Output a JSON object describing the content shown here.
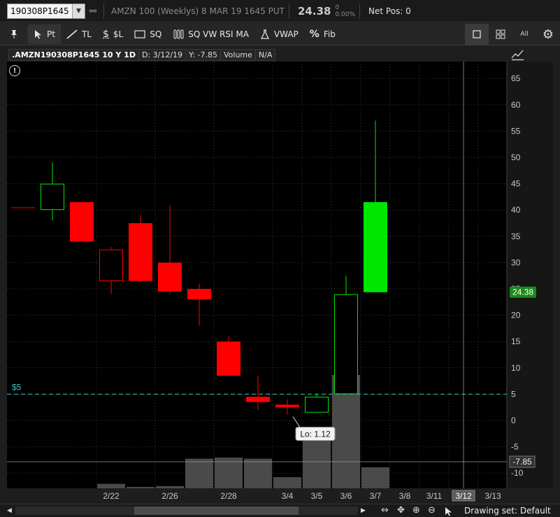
{
  "quote": {
    "symbol": "190308P1645",
    "description": "AMZN 100 (Weeklys) 8 MAR 19 1645 PUT",
    "last": "24.38",
    "change": "0",
    "change_pct": "0.00%",
    "net_pos": "Net Pos: 0"
  },
  "toolbar": {
    "pt": "Pt",
    "tl": "TL",
    "sl": "$L",
    "sq": "SQ",
    "study": "SQ VW RSI MA",
    "vwap": "VWAP",
    "fib": "Fib",
    "all": "All"
  },
  "header": {
    "symbol": ".AMZN190308P1645 10 Y 1D",
    "date": "D: 3/12/19",
    "y": "Y: -7.85",
    "volume": "Volume",
    "na": "N/A"
  },
  "bottom": {
    "drawing_set": "Drawing set: Default"
  },
  "colors": {
    "up": "#00e600",
    "down": "#ff0000",
    "volume": "#4a4a4a",
    "level": "#40c0c0",
    "last_badge": "#1a8a1a",
    "y_badge": "#333333"
  },
  "chart_data": {
    "type": "candlestick",
    "y_ticks": [
      65,
      60,
      55,
      50,
      45,
      40,
      35,
      30,
      25,
      20,
      15,
      10,
      5,
      0,
      -5,
      -10
    ],
    "ylim": [
      -13,
      67
    ],
    "x_labels": [
      {
        "label": "2/22",
        "index": 2
      },
      {
        "label": "2/26",
        "index": 4
      },
      {
        "label": "2/28",
        "index": 6
      },
      {
        "label": "3/4",
        "index": 8
      },
      {
        "label": "3/5",
        "index": 9
      },
      {
        "label": "3/6",
        "index": 10
      },
      {
        "label": "3/7",
        "index": 11
      },
      {
        "label": "3/8",
        "index": 12
      },
      {
        "label": "3/11",
        "index": 13
      },
      {
        "label": "3/12",
        "index": 14
      },
      {
        "label": "3/13",
        "index": 15
      }
    ],
    "candles": [
      {
        "index": 0,
        "open": 40.5,
        "high": 40.5,
        "low": 40.5,
        "close": 40.5,
        "color": "down",
        "filled": true
      },
      {
        "index": 1,
        "open": 40,
        "high": 49,
        "low": 38,
        "close": 45,
        "color": "up",
        "filled": false
      },
      {
        "index": 2,
        "open": 41.5,
        "high": 41.5,
        "low": 34,
        "close": 34,
        "color": "down",
        "filled": true
      },
      {
        "index": 3,
        "open": 26.5,
        "high": 33,
        "low": 24,
        "close": 32.5,
        "color": "down",
        "filled": false
      },
      {
        "index": 4,
        "open": 37.5,
        "high": 39,
        "low": 26.5,
        "close": 26.5,
        "color": "down",
        "filled": true
      },
      {
        "index": 5,
        "open": 30,
        "high": 41,
        "low": 24,
        "close": 24.5,
        "color": "down",
        "filled": true
      },
      {
        "index": 6,
        "open": 25,
        "high": 26,
        "low": 18,
        "close": 23,
        "color": "down",
        "filled": true
      },
      {
        "index": 7,
        "open": 15,
        "high": 16,
        "low": 8.5,
        "close": 8.5,
        "color": "down",
        "filled": true
      },
      {
        "index": 8,
        "open": 4.5,
        "high": 8.5,
        "low": 2,
        "close": 3.5,
        "color": "down",
        "filled": true
      },
      {
        "index": 9,
        "open": 3,
        "high": 4,
        "low": 1.12,
        "close": 2.5,
        "color": "down",
        "filled": true
      },
      {
        "index": 10,
        "open": 1.5,
        "high": 5,
        "low": 1.5,
        "close": 4.5,
        "color": "up",
        "filled": false
      },
      {
        "index": 11,
        "open": 5,
        "high": 27.5,
        "low": 5,
        "close": 24,
        "color": "up",
        "filled": false
      },
      {
        "index": 12,
        "open": 24.38,
        "high": 57,
        "low": 24.38,
        "close": 41.5,
        "color": "up",
        "filled": true
      }
    ],
    "volume_bars": [
      {
        "index": 3,
        "rel": 0.16
      },
      {
        "index": 4,
        "rel": 0.05
      },
      {
        "index": 5,
        "rel": 0.08
      },
      {
        "index": 6,
        "rel": 1.06
      },
      {
        "index": 7,
        "rel": 1.1
      },
      {
        "index": 8,
        "rel": 1.06
      },
      {
        "index": 9,
        "rel": 0.4
      },
      {
        "index": 10,
        "rel": 1.95
      },
      {
        "index": 11,
        "rel": 4.05
      },
      {
        "index": 12,
        "rel": 0.75
      }
    ],
    "level_line": {
      "value": 5,
      "label": "$5"
    },
    "crosshair": {
      "index": 14,
      "value": -7.85,
      "value_label": "-7.85",
      "date_label": "3/12"
    },
    "last_price": {
      "value": 24.38,
      "label": "24.38"
    },
    "callout": {
      "index": 9,
      "value": 1.12,
      "label": "Lo: 1.12"
    }
  }
}
